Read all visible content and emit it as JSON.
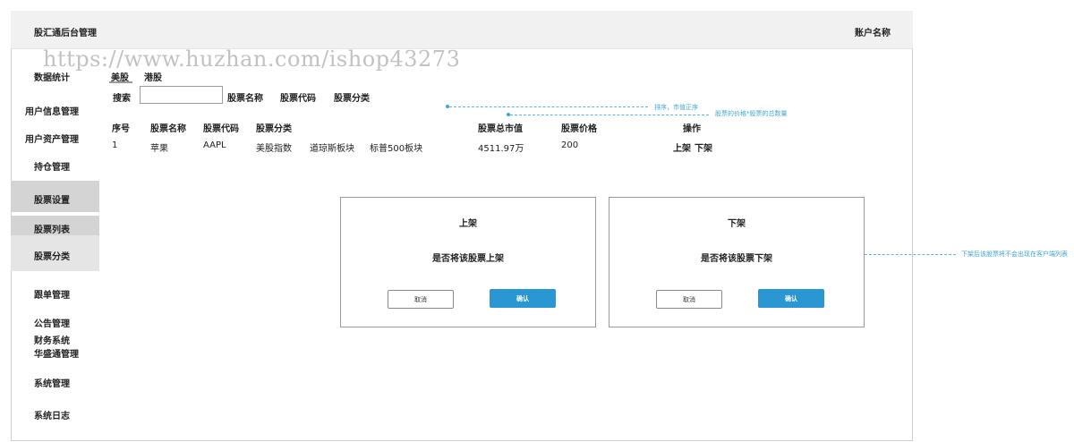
{
  "app_title": "股汇通后台管理",
  "account": "账户名称",
  "watermark": "https://www.huzhan.com/ishop43273",
  "sidebar": {
    "items": [
      {
        "label": "数据统计"
      },
      {
        "label": "用户信息管理"
      },
      {
        "label": "用户资产管理"
      },
      {
        "label": "持仓管理"
      },
      {
        "label": "股票设置"
      },
      {
        "label": "股票列表"
      },
      {
        "label": "股票分类"
      },
      {
        "label": "跟单管理"
      },
      {
        "label": "公告管理"
      },
      {
        "label": "财务系统"
      },
      {
        "label": "华盛通管理"
      },
      {
        "label": "系统管理"
      },
      {
        "label": "系统日志"
      }
    ]
  },
  "tabs": [
    {
      "label": "美股"
    },
    {
      "label": "港股"
    }
  ],
  "search": {
    "label": "搜索",
    "value": "",
    "filters": [
      "股票名称",
      "股票代码",
      "股票分类"
    ]
  },
  "table": {
    "headers": [
      "序号",
      "股票名称",
      "股票代码",
      "股票分类",
      "股票总市值",
      "股票价格",
      "操作"
    ],
    "rows": [
      {
        "index": "1",
        "name": "苹果",
        "code": "AAPL",
        "categories": [
          "美股指数",
          "道琼斯板块",
          "标普500板块"
        ],
        "market_cap": "4511.97万",
        "price": "200",
        "actions": [
          "上架",
          "下架"
        ]
      }
    ]
  },
  "annotations": {
    "sort": "排序，市值正序",
    "market_cap_formula": "股票的价格*股票的总数量",
    "delist": "下架后该股票将不会出现在客户端列表"
  },
  "dialogs": {
    "list": {
      "title": "上架",
      "message": "是否将该股票上架",
      "cancel": "取消",
      "confirm": "确认"
    },
    "delist": {
      "title": "下架",
      "message": "是否将该股票下架",
      "cancel": "取消",
      "confirm": "确认"
    }
  },
  "colors": {
    "accent": "#2a97d2",
    "annotation": "#3fa6da",
    "header_bg": "#f1f1f1",
    "sidebar_active": "#d4d4d4"
  }
}
